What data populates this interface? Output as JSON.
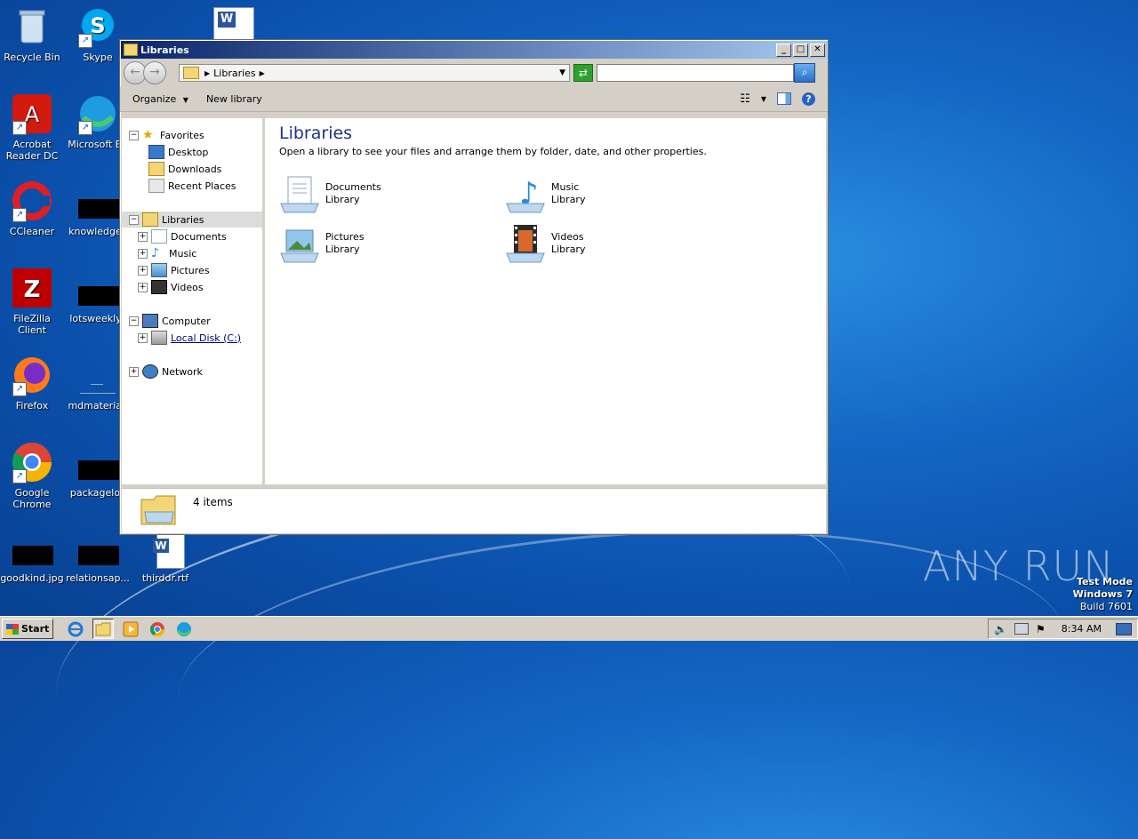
{
  "desktop": {
    "icons": [
      {
        "label": "Recycle Bin"
      },
      {
        "label": "Skype"
      },
      {
        "label": "Acrobat\nReader DC"
      },
      {
        "label": "Microsoft Ed"
      },
      {
        "label": "CCleaner"
      },
      {
        "label": "knowledgec"
      },
      {
        "label": "FileZilla Client"
      },
      {
        "label": "lotsweekly.j"
      },
      {
        "label": "Firefox"
      },
      {
        "label": "mdmaterial."
      },
      {
        "label": "Google\nChrome"
      },
      {
        "label": "packageloc"
      },
      {
        "label": "goodkind.jpg"
      },
      {
        "label": "relationsap..."
      },
      {
        "label": "thirddr.rtf"
      }
    ],
    "watermark": {
      "line1": "Test Mode",
      "line2": "Windows 7",
      "line3": "Build 7601"
    },
    "anyrun": "ANY  RUN"
  },
  "window": {
    "title": "Libraries",
    "address": {
      "crumb": "Libraries",
      "search_value": ""
    },
    "toolbar": {
      "organize": "Organize",
      "new_library": "New library"
    },
    "nav": {
      "favorites": "Favorites",
      "desktop": "Desktop",
      "downloads": "Downloads",
      "recent": "Recent Places",
      "libraries": "Libraries",
      "documents": "Documents",
      "music": "Music",
      "pictures": "Pictures",
      "videos": "Videos",
      "computer": "Computer",
      "local_disk": "Local Disk (C:)",
      "network": "Network"
    },
    "content": {
      "heading": "Libraries",
      "description": "Open a library to see your files and arrange them by folder, date, and other properties.",
      "libraries": [
        {
          "name": "Documents",
          "type": "Library"
        },
        {
          "name": "Music",
          "type": "Library"
        },
        {
          "name": "Pictures",
          "type": "Library"
        },
        {
          "name": "Videos",
          "type": "Library"
        }
      ]
    },
    "status": {
      "count": "4 items"
    }
  },
  "taskbar": {
    "start": "Start",
    "clock": "8:34 AM"
  }
}
